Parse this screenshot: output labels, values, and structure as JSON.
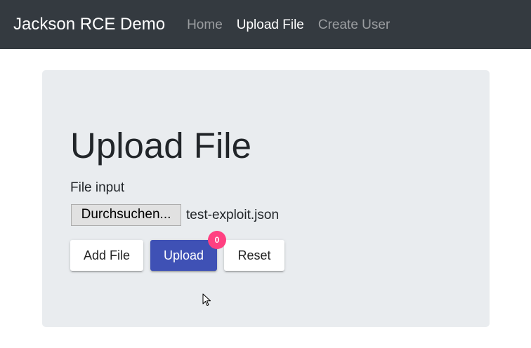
{
  "navbar": {
    "brand": "Jackson RCE Demo",
    "links": [
      {
        "label": "Home",
        "active": false
      },
      {
        "label": "Upload File",
        "active": true
      },
      {
        "label": "Create User",
        "active": false
      }
    ]
  },
  "main": {
    "title": "Upload File",
    "file_label": "File input",
    "browse_label": "Durchsuchen...",
    "file_name": "test-exploit.json",
    "buttons": {
      "add_file": "Add File",
      "upload": "Upload",
      "reset": "Reset"
    },
    "upload_badge": "0"
  },
  "colors": {
    "navbar_bg": "#343a40",
    "jumbotron_bg": "#e9ecef",
    "primary": "#3f51b5",
    "badge": "#ff4081"
  },
  "icons": {
    "cursor": "mouse-pointer-icon"
  }
}
